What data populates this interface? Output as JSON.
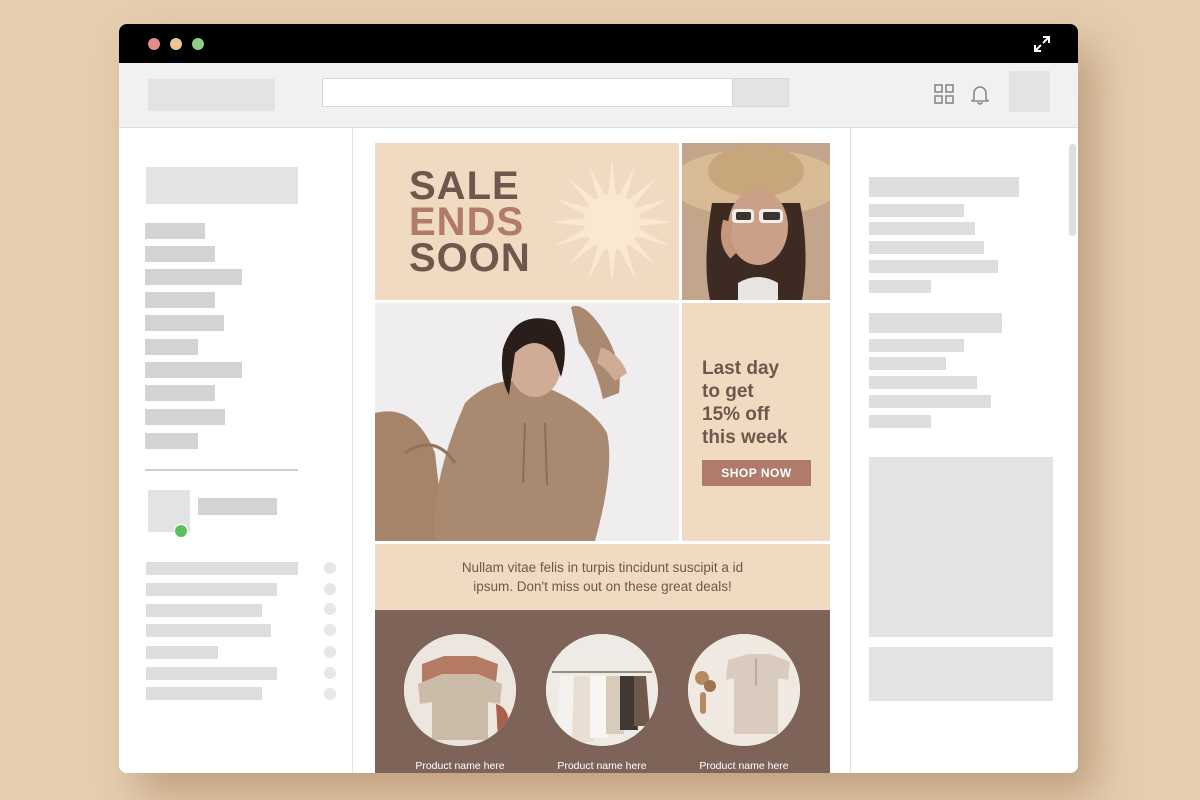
{
  "window": {
    "traffic_lights": [
      "#e38b8b",
      "#edc58e",
      "#8fcf85"
    ]
  },
  "toolbar": {
    "apps_icon": "grid-icon",
    "notifications_icon": "bell-icon"
  },
  "email": {
    "hero": {
      "headline": [
        "SALE",
        "ENDS",
        "SOON"
      ],
      "headline_colors": [
        "#6e574c",
        "#b07b6c",
        "#6e574c"
      ]
    },
    "offer": {
      "lines": [
        "Last day",
        "to get",
        "15% off",
        "this week"
      ],
      "cta_label": "SHOP NOW"
    },
    "message": {
      "lines": [
        "Nullam vitae felis in turpis tincidunt suscipit a id",
        "ipsum. Don't miss out on these great deals!"
      ]
    },
    "products": [
      {
        "name": "Product name here"
      },
      {
        "name": "Product name here"
      },
      {
        "name": "Product name here"
      }
    ]
  },
  "colors": {
    "accent": "#b07b6c",
    "panel": "#f0dbc2",
    "dark_panel": "#7e6458",
    "text": "#6e574c",
    "online_status": "#5cbf5c"
  }
}
